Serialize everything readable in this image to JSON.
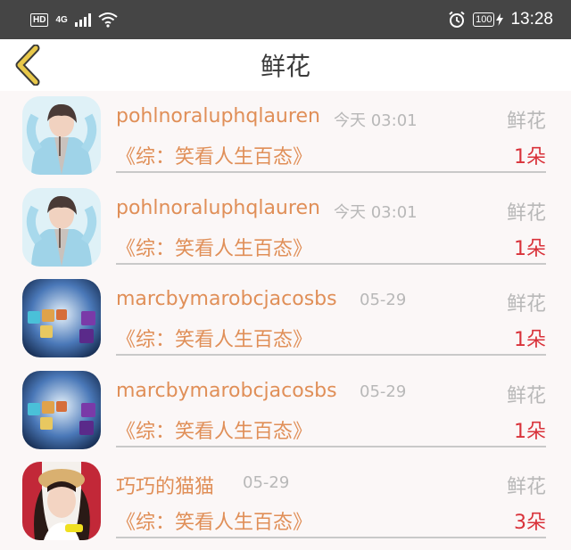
{
  "status_bar": {
    "hd": "HD",
    "network": "4G",
    "battery": "100",
    "time": "13:28"
  },
  "header": {
    "title": "鲜花",
    "back_icon": "chevron-left-icon"
  },
  "colors": {
    "accent": "#e08f58",
    "count": "#d9323a",
    "muted": "#b8b8b8",
    "back_icon": "#e8c84a"
  },
  "records": [
    {
      "username": "pohlnoraluphqlauren",
      "time": "今天 03:01",
      "gift_type": "鲜花",
      "book": "《综：笑看人生百态》",
      "count": "1朵",
      "avatar": "boy"
    },
    {
      "username": "pohlnoraluphqlauren",
      "time": "今天 03:01",
      "gift_type": "鲜花",
      "book": "《综：笑看人生百态》",
      "count": "1朵",
      "avatar": "boy"
    },
    {
      "username": "marcbymarobcjacosbs",
      "time": "05-29",
      "gift_type": "鲜花",
      "book": "《综：笑看人生百态》",
      "count": "1朵",
      "avatar": "cubes"
    },
    {
      "username": "marcbymarobcjacosbs",
      "time": "05-29",
      "gift_type": "鲜花",
      "book": "《综：笑看人生百态》",
      "count": "1朵",
      "avatar": "cubes"
    },
    {
      "username": "巧巧的猫猫",
      "time": "05-29",
      "gift_type": "鲜花",
      "book": "《综：笑看人生百态》",
      "count": "3朵",
      "avatar": "girl"
    }
  ]
}
